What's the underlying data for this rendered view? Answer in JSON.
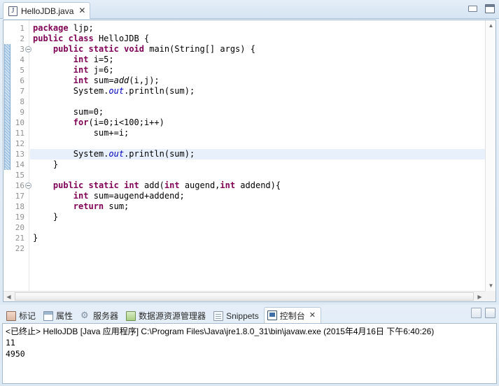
{
  "window": {
    "minimize_label": "Minimize",
    "maximize_label": "Maximize"
  },
  "editor": {
    "tab": {
      "label": "HelloJDB.java",
      "icon": "java-file-icon",
      "close_label": "✕"
    },
    "current_line": 13,
    "change_bar_lines": [
      3,
      14
    ],
    "fold_lines": [
      3,
      16
    ],
    "scroll": {
      "up_arrow": "▲",
      "down_arrow": "▼",
      "left_arrow": "◀",
      "right_arrow": "▶"
    },
    "code_lines": [
      {
        "n": 1,
        "html": "<span class=\"kw\">package</span> ljp;"
      },
      {
        "n": 2,
        "html": "<span class=\"kw\">public</span> <span class=\"kw\">class</span> HelloJDB {"
      },
      {
        "n": 3,
        "html": "    <span class=\"kw\">public</span> <span class=\"kw\">static</span> <span class=\"kw\">void</span> main(String[] args) {"
      },
      {
        "n": 4,
        "html": "        <span class=\"kw\">int</span> i=5;"
      },
      {
        "n": 5,
        "html": "        <span class=\"kw\">int</span> j=6;"
      },
      {
        "n": 6,
        "html": "        <span class=\"kw\">int</span> sum=<span class=\"mth\">add</span>(i,j);"
      },
      {
        "n": 7,
        "html": "        System.<span class=\"fld\">out</span>.println(sum);"
      },
      {
        "n": 8,
        "html": ""
      },
      {
        "n": 9,
        "html": "        sum=0;"
      },
      {
        "n": 10,
        "html": "        <span class=\"kw\">for</span>(i=0;i&lt;100;i++)"
      },
      {
        "n": 11,
        "html": "            sum+=i;"
      },
      {
        "n": 12,
        "html": ""
      },
      {
        "n": 13,
        "html": "        System.<span class=\"fld\">out</span>.println(sum);"
      },
      {
        "n": 14,
        "html": "    }"
      },
      {
        "n": 15,
        "html": ""
      },
      {
        "n": 16,
        "html": "    <span class=\"kw\">public</span> <span class=\"kw\">static</span> <span class=\"kw\">int</span> add(<span class=\"kw\">int</span> augend,<span class=\"kw\">int</span> addend){"
      },
      {
        "n": 17,
        "html": "        <span class=\"kw\">int</span> sum=augend+addend;"
      },
      {
        "n": 18,
        "html": "        <span class=\"kw\">return</span> sum;"
      },
      {
        "n": 19,
        "html": "    }"
      },
      {
        "n": 20,
        "html": ""
      },
      {
        "n": 21,
        "html": "}"
      },
      {
        "n": 22,
        "html": ""
      }
    ]
  },
  "bottom_view": {
    "tabs": [
      {
        "label": "标记",
        "icon": "marker-icon",
        "active": false
      },
      {
        "label": "属性",
        "icon": "properties-icon",
        "active": false
      },
      {
        "label": "服务器",
        "icon": "servers-icon",
        "active": false
      },
      {
        "label": "数据源资源管理器",
        "icon": "datasource-icon",
        "active": false
      },
      {
        "label": "Snippets",
        "icon": "snippets-icon",
        "active": false
      },
      {
        "label": "控制台",
        "icon": "console-icon",
        "active": true,
        "close_label": "✕"
      }
    ],
    "toolbar": [
      {
        "name": "display-selected-console-button"
      },
      {
        "name": "open-console-menu-button"
      }
    ]
  },
  "console": {
    "status_line": "<已终止> HelloJDB [Java 应用程序] C:\\Program Files\\Java\\jre1.8.0_31\\bin\\javaw.exe (2015年4月16日 下午6:40:26)",
    "output": [
      "11",
      "4950"
    ]
  },
  "colors": {
    "keyword": "#7F0055",
    "field": "#0000C0",
    "current_line_bg": "#E8F1FB",
    "chrome": "#DDE9F4"
  }
}
